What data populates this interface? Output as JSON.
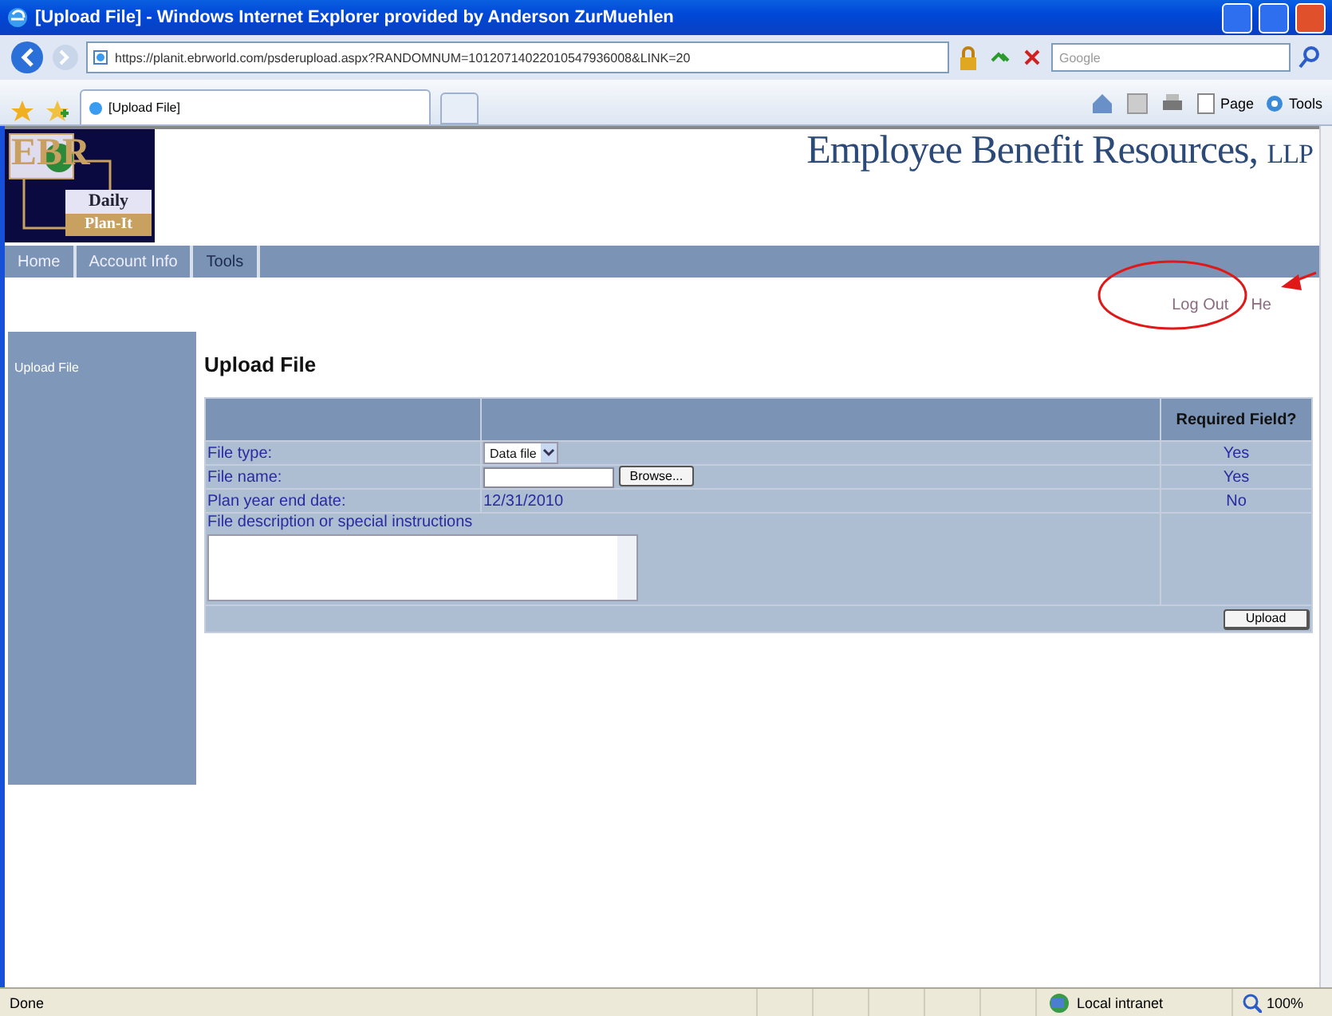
{
  "window": {
    "title": "[Upload File] - Windows Internet Explorer provided by Anderson ZurMuehlen"
  },
  "address_bar": {
    "url": "https://planit.ebrworld.com/psderupload.aspx?RANDOMNUM=10120714022010547936008&LINK=20"
  },
  "search": {
    "placeholder": "Google"
  },
  "tabs": [
    {
      "label": "[Upload File]",
      "selected": true
    }
  ],
  "command_bar": [
    {
      "label": "Page"
    },
    {
      "label": "Tools"
    }
  ],
  "site": {
    "logo": {
      "letters": "EBR",
      "line1": "Daily",
      "line2": "Plan-It"
    },
    "company": "Employee Benefit Resources,",
    "suffix": "LLP"
  },
  "nav": [
    {
      "label": "Home",
      "selected": false
    },
    {
      "label": "Account Info",
      "selected": false
    },
    {
      "label": "Tools",
      "selected": true
    }
  ],
  "top_links": [
    {
      "label": "Log Out"
    },
    {
      "label": "He"
    }
  ],
  "sidebar": {
    "items": [
      {
        "label": "Upload File"
      }
    ]
  },
  "heading": "Upload File",
  "form": {
    "required_header": "Required Field?",
    "rows": [
      {
        "kind": "select",
        "label": "File type:",
        "value": "Data file",
        "required": "Yes"
      },
      {
        "kind": "file",
        "label": "File name:",
        "button": "Browse...",
        "required": "Yes"
      },
      {
        "kind": "text",
        "label": "Plan year end date:",
        "value": "12/31/2010",
        "required": "No"
      },
      {
        "kind": "textarea",
        "label": "File description or special instructions"
      }
    ],
    "submit": "Upload"
  },
  "status_bar": {
    "status": "Done",
    "zone": "Local intranet",
    "zoom": "100%"
  }
}
